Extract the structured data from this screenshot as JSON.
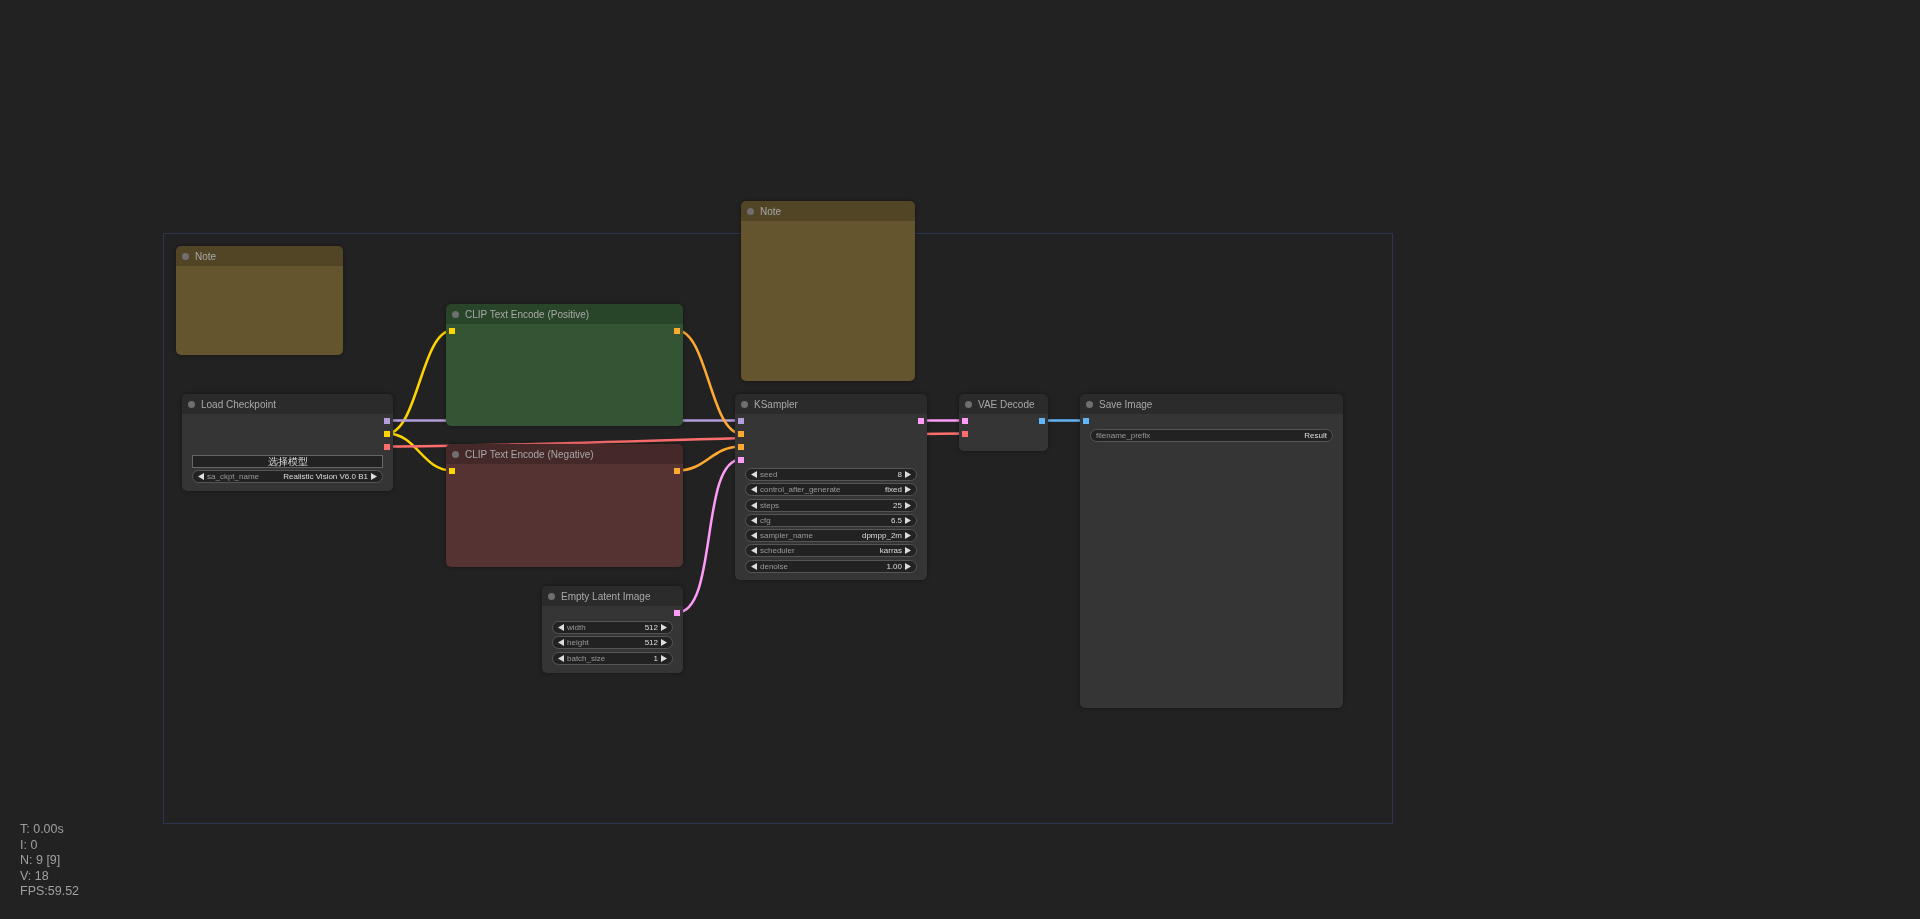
{
  "nodes": [
    {
      "title": "Note",
      "color": "#65552f"
    },
    {
      "title": "Note",
      "color": "#65552f"
    },
    {
      "title": "CLIP Text Encode (Positive)",
      "color": "#335533",
      "inputs": [
        {
          "color": "#ffd500"
        }
      ],
      "outputs": [
        {
          "color": "#ffa931"
        }
      ]
    },
    {
      "title": "Load Checkpoint",
      "color": "#353535",
      "outputs": [
        {
          "color": "#b39ddb"
        },
        {
          "color": "#ffd500"
        },
        {
          "color": "#ff6e6e"
        }
      ],
      "widgets": [
        {
          "kind": "button",
          "label": "选择模型"
        },
        {
          "kind": "combo",
          "label": "sa_ckpt_name",
          "value": "Realistic Vision V6.0 B1"
        }
      ]
    },
    {
      "title": "KSampler",
      "color": "#353535",
      "inputs": [
        {
          "color": "#b39ddb"
        },
        {
          "color": "#ffa931"
        },
        {
          "color": "#ffa931"
        },
        {
          "color": "#ff9cf9"
        }
      ],
      "outputs": [
        {
          "color": "#ff9cf9"
        }
      ],
      "widgets": [
        {
          "kind": "number",
          "label": "seed",
          "value": "8"
        },
        {
          "kind": "combo",
          "label": "control_after_generate",
          "value": "fixed"
        },
        {
          "kind": "number",
          "label": "steps",
          "value": "25"
        },
        {
          "kind": "number",
          "label": "cfg",
          "value": "6.5"
        },
        {
          "kind": "combo",
          "label": "sampler_name",
          "value": "dpmpp_2m"
        },
        {
          "kind": "combo",
          "label": "scheduler",
          "value": "karras"
        },
        {
          "kind": "number",
          "label": "denoise",
          "value": "1.00"
        }
      ]
    },
    {
      "title": "VAE Decode",
      "color": "#353535",
      "inputs": [
        {
          "color": "#ff9cf9"
        },
        {
          "color": "#ff6e6e"
        }
      ],
      "outputs": [
        {
          "color": "#64b5f6"
        }
      ]
    },
    {
      "title": "Save Image",
      "color": "#353535",
      "inputs": [
        {
          "color": "#64b5f6"
        }
      ],
      "widgets": [
        {
          "kind": "text",
          "label": "filename_prefix",
          "value": "Result"
        }
      ]
    },
    {
      "title": "CLIP Text Encode (Negative)",
      "color": "#553333",
      "inputs": [
        {
          "color": "#ffd500"
        }
      ],
      "outputs": [
        {
          "color": "#ffa931"
        }
      ]
    },
    {
      "title": "Empty Latent Image",
      "color": "#353535",
      "outputs": [
        {
          "color": "#ff9cf9"
        }
      ],
      "widgets": [
        {
          "kind": "number",
          "label": "width",
          "value": "512"
        },
        {
          "kind": "number",
          "label": "height",
          "value": "512"
        },
        {
          "kind": "number",
          "label": "batch_size",
          "value": "1"
        }
      ]
    }
  ],
  "stats": [
    "T: 0.00s",
    "I: 0",
    "N: 9 [9]",
    "V: 18",
    "FPS:59.52"
  ]
}
